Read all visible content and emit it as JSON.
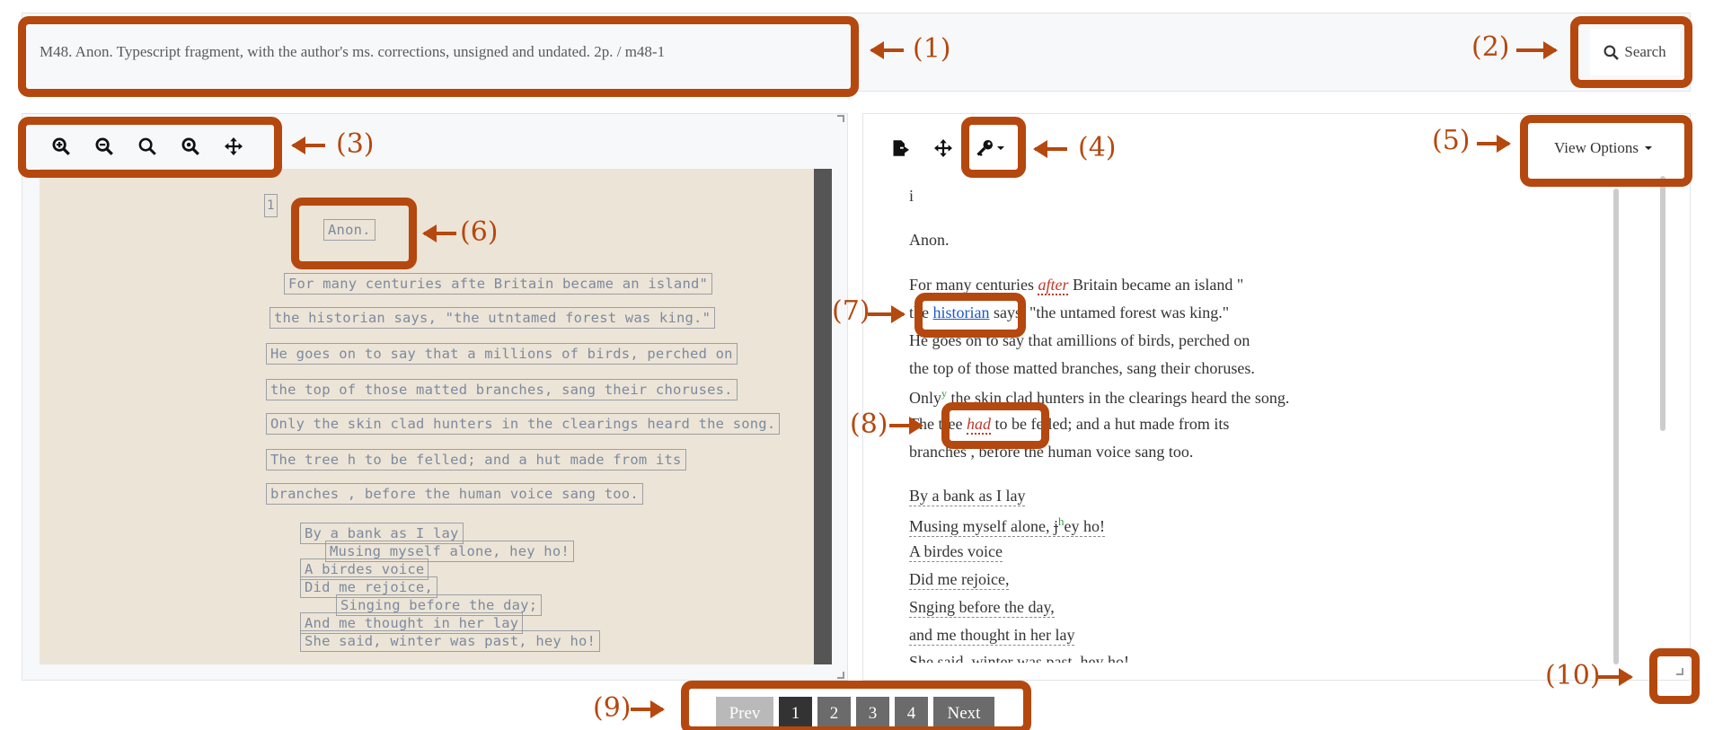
{
  "header": {
    "title": "M48. Anon. Typescript fragment, with the author's ms. corrections, unsigned and undated. 2p.  /  m48-1",
    "search_label": "Search"
  },
  "image_toolbar": {
    "icons": [
      "zoom-in-icon",
      "zoom-out-icon",
      "zoom-reset-icon",
      "zoom-fit-icon",
      "pan-move-icon"
    ]
  },
  "text_toolbar": {
    "icons": [
      "export-icon",
      "pan-move-icon",
      "key-icon"
    ],
    "view_options_label": "View Options"
  },
  "typescript_lines": [
    "Anon.",
    "For many centuries afte Britain became an island\"",
    "the historian says, \"the utntamed forest was king.\"",
    "He goes on to say that a millions of birds, perched on",
    "the top of those matted branches, sang  their choruses.",
    "Only  the skin clad hunters in the clearings heard the song.",
    "The tree h   to be felled; and a hut made from its",
    "branches  , before the human voice sang too.",
    "By a bank as I lay",
    "Musing myself alone, hey ho!",
    "A birdes voice",
    "Did me rejoice,",
    "Singing before the day;",
    "And me thought in her lay",
    "She said, winter was past, hey ho!"
  ],
  "transcription": {
    "page_marker": "i",
    "author": "Anon.",
    "line1_a": "For many centuries ",
    "line1_emph": "after",
    "line1_b": " Britain became an island \"",
    "line2_a": "the ",
    "line2_link": "historian",
    "line2_b": " says, \"the untamed forest was king.\"",
    "line3": "He goes on to say that amillions of birds, perched on",
    "line4": "the top of those matted branches, sang their choruses.",
    "line5_a": "Only",
    "line5_sup": "y",
    "line5_b": " the skin clad hunters in the clearings heard the song.",
    "line6_a": "The tree ",
    "line6_emph": "had",
    "line6_b": " to be felled; and a hut made from its",
    "line7": "branches , before the human voice sang too.",
    "verse1": "By a bank as I lay",
    "verse2_a": "Musing myself alone, ",
    "verse2_strike": "j",
    "verse2_sup": "h",
    "verse2_b": "ey ho!",
    "verse3": "A birdes voice",
    "verse4": "Did me rejoice,",
    "verse5": "Snging before the day,",
    "verse6": "and me thought in her lay",
    "verse7": "She said, winter was past, hey ho!"
  },
  "pager": {
    "prev": "Prev",
    "pages": [
      "1",
      "2",
      "3",
      "4"
    ],
    "next": "Next"
  },
  "callouts": [
    "(1)",
    "(2)",
    "(3)",
    "(4)",
    "(5)",
    "(6)",
    "(7)",
    "(8)",
    "(9)",
    "(10)"
  ],
  "colors": {
    "callout": "#b5480e",
    "emphasis": "#c0392b",
    "link": "#1a57c9",
    "pager": "#6b6b6b"
  }
}
